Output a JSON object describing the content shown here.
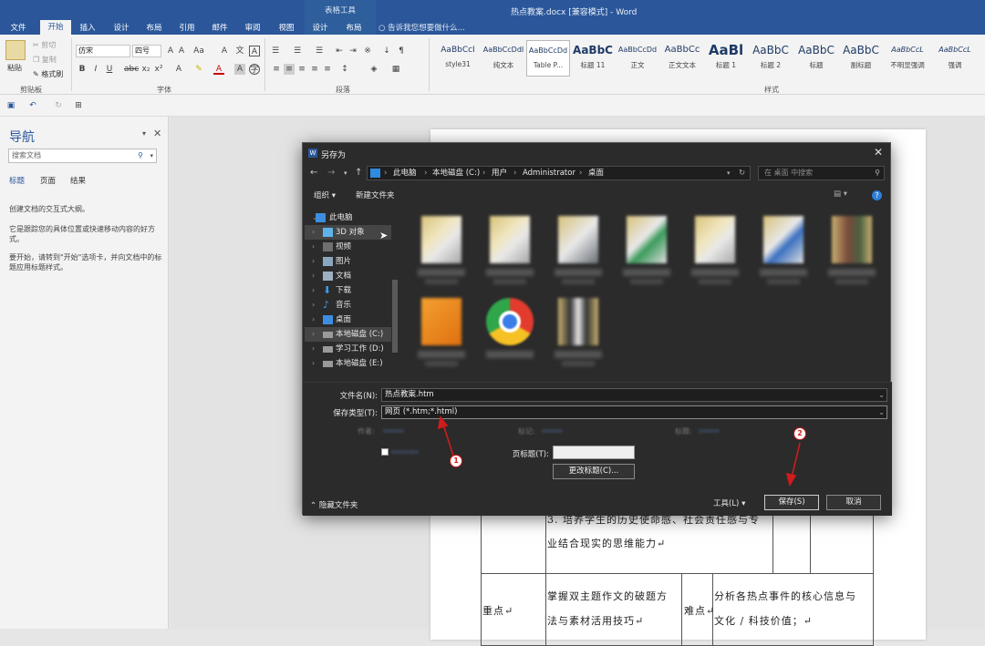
{
  "window": {
    "title": "热点教案.docx [兼容模式] - Word",
    "contextual_group": "表格工具"
  },
  "ribbon_tabs": [
    {
      "label": "文件",
      "active": false
    },
    {
      "label": "开始",
      "active": true
    },
    {
      "label": "插入",
      "active": false
    },
    {
      "label": "设计",
      "active": false
    },
    {
      "label": "布局",
      "active": false
    },
    {
      "label": "引用",
      "active": false
    },
    {
      "label": "邮件",
      "active": false
    },
    {
      "label": "审阅",
      "active": false
    },
    {
      "label": "视图",
      "active": false
    },
    {
      "label": "设计",
      "active": false
    },
    {
      "label": "布局",
      "active": false
    }
  ],
  "tell_me": "告诉我您想要做什么...",
  "clipboard": {
    "paste": "粘贴",
    "cut": "剪切",
    "copy": "复制",
    "format_painter": "格式刷",
    "group": "剪贴板"
  },
  "font": {
    "name": "仿宋",
    "size": "四号",
    "group": "字体"
  },
  "paragraph": {
    "group": "段落"
  },
  "styles": {
    "group": "样式",
    "items": [
      {
        "sample": "AaBbCcI",
        "name": "style31"
      },
      {
        "sample": "AaBbCcDdI",
        "name": "纯文本"
      },
      {
        "sample": "AaBbCcDd",
        "name": "Table P..."
      },
      {
        "sample": "AaBbC",
        "name": "标题 11"
      },
      {
        "sample": "AaBbCcDd",
        "name": "正文"
      },
      {
        "sample": "AaBbCc",
        "name": "正文文本"
      },
      {
        "sample": "AaBl",
        "name": "标题 1"
      },
      {
        "sample": "AaBbC",
        "name": "标题 2"
      },
      {
        "sample": "AaBbC",
        "name": "标题"
      },
      {
        "sample": "AaBbC",
        "name": "副标题"
      },
      {
        "sample": "AaBbCcL",
        "name": "不明显强调"
      },
      {
        "sample": "AaBbCcL",
        "name": "强调"
      }
    ]
  },
  "nav_pane": {
    "title": "导航",
    "search_placeholder": "搜索文档",
    "tabs": [
      "标题",
      "页面",
      "结果"
    ],
    "paragraphs": [
      "创建文档的交互式大纲。",
      "它是跟踪您的具体位置或快速移动内容的好方式。",
      "要开始，请转到\"开始\"选项卡，并向文档中的标题应用标题样式。"
    ]
  },
  "document": {
    "row1_text1": "3.  培养学生的历史使命感、社会责任感与专",
    "row1_text2": "业结合现实的思维能力↵",
    "label_zhongdian": "重点↵",
    "zhongdian_text1": "掌握双主题作文的破题方",
    "zhongdian_text2": "法与素材活用技巧↵",
    "label_nandian": "难点↵",
    "nandian_text1": "分析各热点事件的核心信息与",
    "nandian_text2": "文化 / 科技价值；↵"
  },
  "dialog": {
    "title": "另存为",
    "address": [
      "此电脑",
      "本地磁盘 (C:)",
      "用户",
      "Administrator",
      "桌面"
    ],
    "search_placeholder": "在 桌面 中搜索",
    "organize": "组织 ▾",
    "new_folder": "新建文件夹",
    "tree": [
      {
        "label": "此电脑",
        "icon": "computer-icon"
      },
      {
        "label": "3D 对象",
        "icon": "3d-objects-icon",
        "selected": true
      },
      {
        "label": "视频",
        "icon": "video-icon"
      },
      {
        "label": "图片",
        "icon": "pictures-icon"
      },
      {
        "label": "文档",
        "icon": "documents-icon"
      },
      {
        "label": "下载",
        "icon": "download-icon"
      },
      {
        "label": "音乐",
        "icon": "music-icon"
      },
      {
        "label": "桌面",
        "icon": "desktop-icon"
      },
      {
        "label": "本地磁盘 (C:)",
        "icon": "drive-icon",
        "selected": true
      },
      {
        "label": "学习工作 (D:)",
        "icon": "drive-icon"
      },
      {
        "label": "本地磁盘 (E:)",
        "icon": "drive-icon"
      }
    ],
    "filename_label": "文件名(N):",
    "filename_value": "热点教案.htm",
    "filetype_label": "保存类型(T):",
    "filetype_value": "网页 (*.htm;*.html)",
    "authors_label": "作者:",
    "tags_label": "标记:",
    "title_label": "标题:",
    "page_title_label": "页标题(T):",
    "change_title_button": "更改标题(C)...",
    "hide_folders": "隐藏文件夹",
    "tools": "工具(L)",
    "save": "保存(S)",
    "cancel": "取消",
    "annotations": [
      "1",
      "2"
    ]
  },
  "colors": {
    "word_blue": "#2b579a",
    "dialog_bg": "#2b2b2b",
    "annotation_red": "#d01c1c"
  }
}
